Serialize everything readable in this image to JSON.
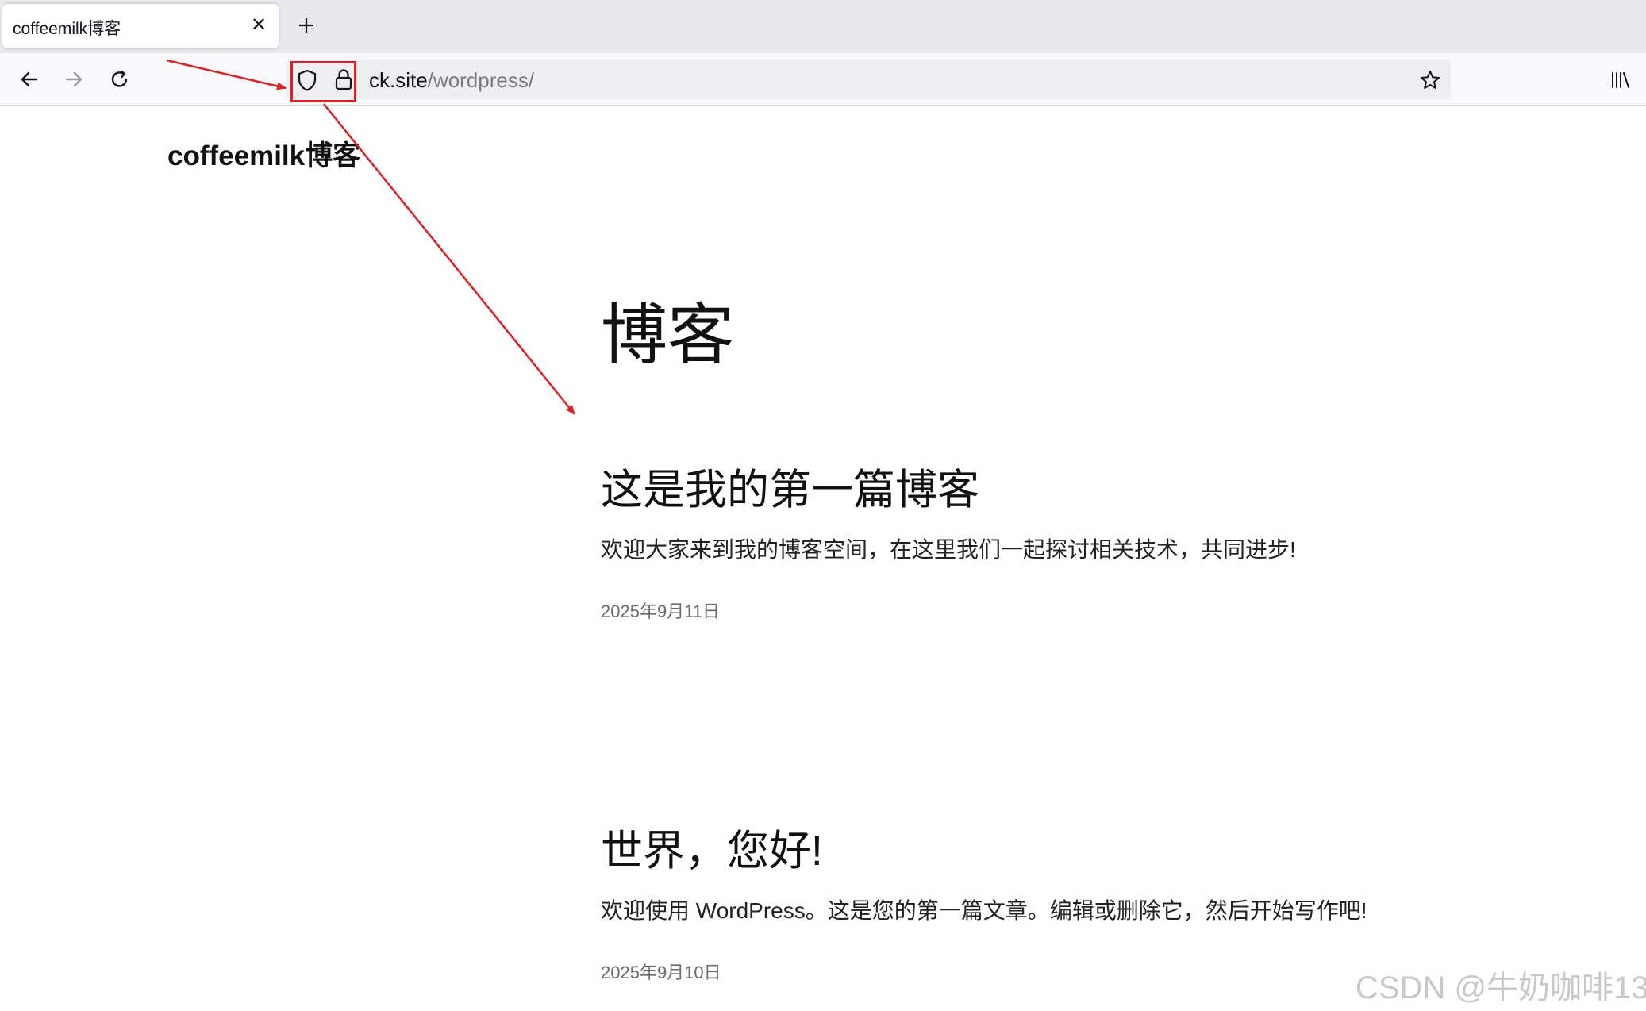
{
  "browser": {
    "tab": {
      "title": "coffeemilk博客",
      "close_icon": "close-icon"
    },
    "new_tab_icon": "plus-icon",
    "nav": {
      "back_icon": "arrow-left-icon",
      "forward_icon": "arrow-right-icon",
      "reload_icon": "reload-icon"
    },
    "urlbar": {
      "domain": "ck.site",
      "path": "/wordpress/",
      "tracking_icon": "shield-icon",
      "security_icon": "lock-icon",
      "bookmark_icon": "star-icon"
    },
    "library_icon": "library-icon"
  },
  "page": {
    "site_title": "coffeemilk博客",
    "heading": "博客",
    "posts": [
      {
        "title": "这是我的第一篇博客",
        "excerpt": "欢迎大家来到我的博客空间，在这里我们一起探讨相关技术，共同进步!",
        "date": "2025年9月11日"
      },
      {
        "title": "世界，您好!",
        "excerpt": "欢迎使用 WordPress。这是您的第一篇文章。编辑或删除它，然后开始写作吧!",
        "date": "2025年9月10日"
      }
    ]
  },
  "watermark": "CSDN @牛奶咖啡13",
  "colors": {
    "annotation": "#e51c24",
    "tabbar_bg": "#e9e9ec",
    "toolbar_bg": "#f9f9fb",
    "urlbar_bg": "#eeeef1"
  }
}
